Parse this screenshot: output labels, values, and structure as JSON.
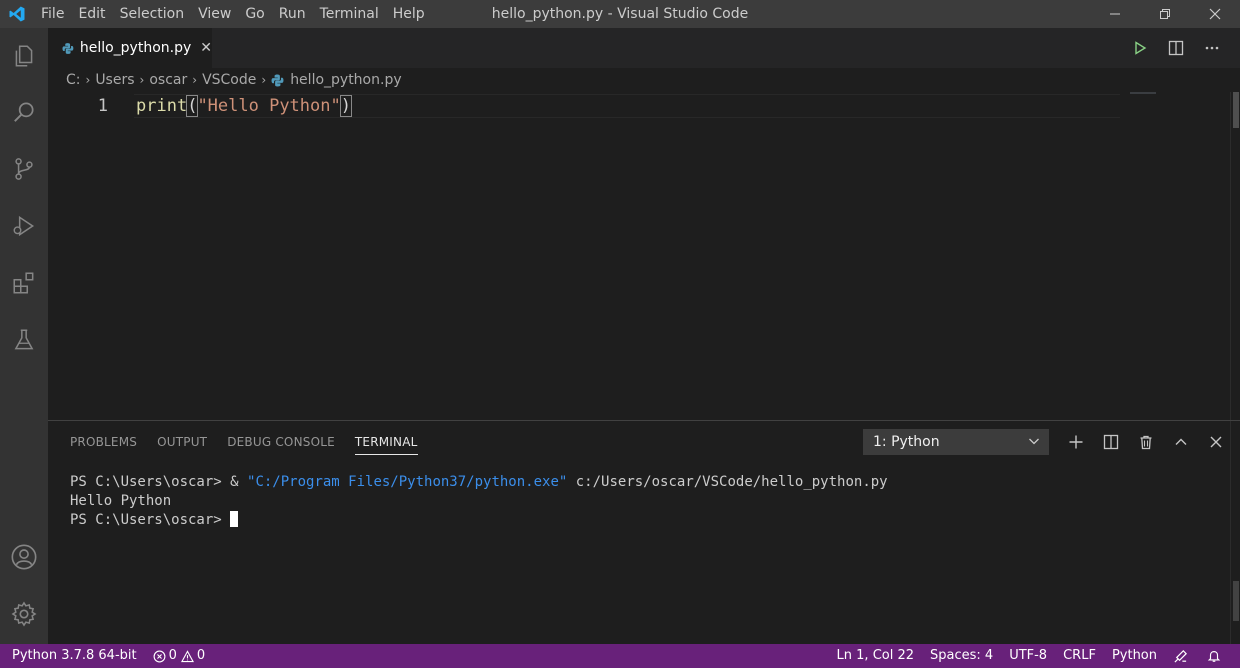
{
  "window": {
    "title": "hello_python.py - Visual Studio Code"
  },
  "menu": [
    "File",
    "Edit",
    "Selection",
    "View",
    "Go",
    "Run",
    "Terminal",
    "Help"
  ],
  "activity_bar": [
    "explorer-icon",
    "search-icon",
    "source-control-icon",
    "run-debug-icon",
    "extensions-icon",
    "testing-flask-icon",
    "account-icon",
    "manage-gear-icon"
  ],
  "tab": {
    "label": "hello_python.py",
    "close": "✕"
  },
  "breadcrumb": {
    "drive": "C:",
    "parts": [
      "Users",
      "oscar",
      "VSCode"
    ],
    "file": "hello_python.py"
  },
  "editor": {
    "line_number": "1",
    "tokens": {
      "fn": "print",
      "open": "(",
      "str": "\"Hello Python\"",
      "close": ")"
    }
  },
  "panel": {
    "tabs": [
      "PROBLEMS",
      "OUTPUT",
      "DEBUG CONSOLE",
      "TERMINAL"
    ],
    "active_tab": "TERMINAL",
    "terminal_select": "1: Python",
    "terminal": {
      "line1_prompt": "PS C:\\Users\\oscar> & ",
      "line1_string": "\"C:/Program Files/Python37/python.exe\"",
      "line1_arg": " c:/Users/oscar/VSCode/hello_python.py",
      "line2": "Hello Python",
      "line3_prompt": "PS C:\\Users\\oscar> "
    }
  },
  "status_bar": {
    "interpreter": "Python 3.7.8 64-bit",
    "errors": "0",
    "warnings": "0",
    "position": "Ln 1, Col 22",
    "spaces": "Spaces: 4",
    "encoding": "UTF-8",
    "eol": "CRLF",
    "language": "Python"
  },
  "colors": {
    "status_bar": "#68217a",
    "accent": "#0078d4",
    "string": "#ce9178",
    "function": "#dcdcaa",
    "terminal_string": "#3b8eea"
  }
}
